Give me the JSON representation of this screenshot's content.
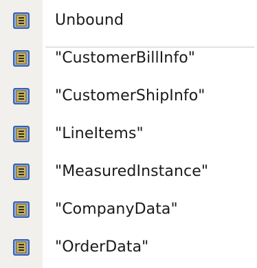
{
  "menu": {
    "items": [
      {
        "label": "Unbound",
        "icon": "data-source-icon"
      },
      {
        "label": "\"CustomerBillInfo\"",
        "icon": "data-source-icon"
      },
      {
        "label": "\"CustomerShipInfo\"",
        "icon": "data-source-icon"
      },
      {
        "label": "\"LineItems\"",
        "icon": "data-source-icon"
      },
      {
        "label": "\"MeasuredInstance\"",
        "icon": "data-source-icon"
      },
      {
        "label": "\"CompanyData\"",
        "icon": "data-source-icon"
      },
      {
        "label": "\"OrderData\"",
        "icon": "data-source-icon"
      }
    ]
  },
  "colors": {
    "gutter": "#f1f0ec",
    "separator": "#c9c6bc",
    "icon_frame": "#3a5fa8",
    "icon_fill": "#cdb45a"
  }
}
